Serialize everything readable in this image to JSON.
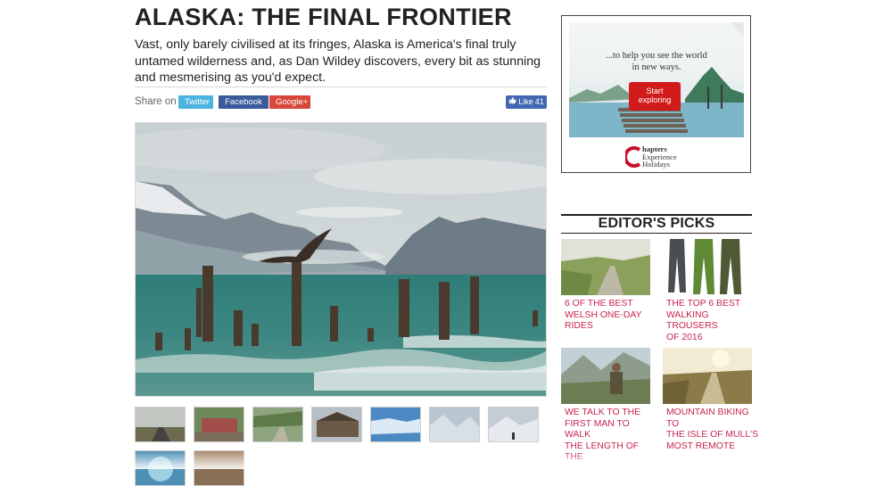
{
  "article": {
    "title": "ALASKA: THE FINAL FRONTIER",
    "standfirst": "Vast, only barely civilised at its fringes, Alaska is America's final truly untamed wilderness and, as Dan Wildey discovers, every bit as stunning and mesmerising as you'd expect."
  },
  "share": {
    "label": "Share on",
    "buttons": [
      "Twitter",
      "Facebook",
      "Google+"
    ],
    "like_label": "Like",
    "like_count": "41"
  },
  "ad": {
    "tagline_line1": "...to help you see the world",
    "tagline_line2": "in new ways.",
    "cta_line1": "Start",
    "cta_line2": "exploring",
    "brand_line1": "hapters",
    "brand_line2": "Experience",
    "brand_line3": "Holidays"
  },
  "editors_picks": {
    "title": "EDITOR'S PICKS",
    "items": [
      {
        "caption_l1": "6 OF THE BEST",
        "caption_l2": "WELSH ONE-DAY",
        "caption_l3": "RIDES"
      },
      {
        "caption_l1": "THE TOP 6 BEST",
        "caption_l2": "WALKING TROUSERS",
        "caption_l3": "OF 2016"
      },
      {
        "caption_l1": "WE TALK TO THE",
        "caption_l2": "FIRST MAN TO WALK",
        "caption_l3": "THE LENGTH OF THE"
      },
      {
        "caption_l1": "MOUNTAIN BIKING TO",
        "caption_l2": "THE ISLE OF MULL'S",
        "caption_l3": "MOST REMOTE"
      }
    ]
  },
  "colors": {
    "twitter": "#4cb3e0",
    "facebook": "#3b5a9a",
    "google": "#d9473a",
    "caption_accent": "#c8244d",
    "ad_cta": "#d11a1a"
  }
}
